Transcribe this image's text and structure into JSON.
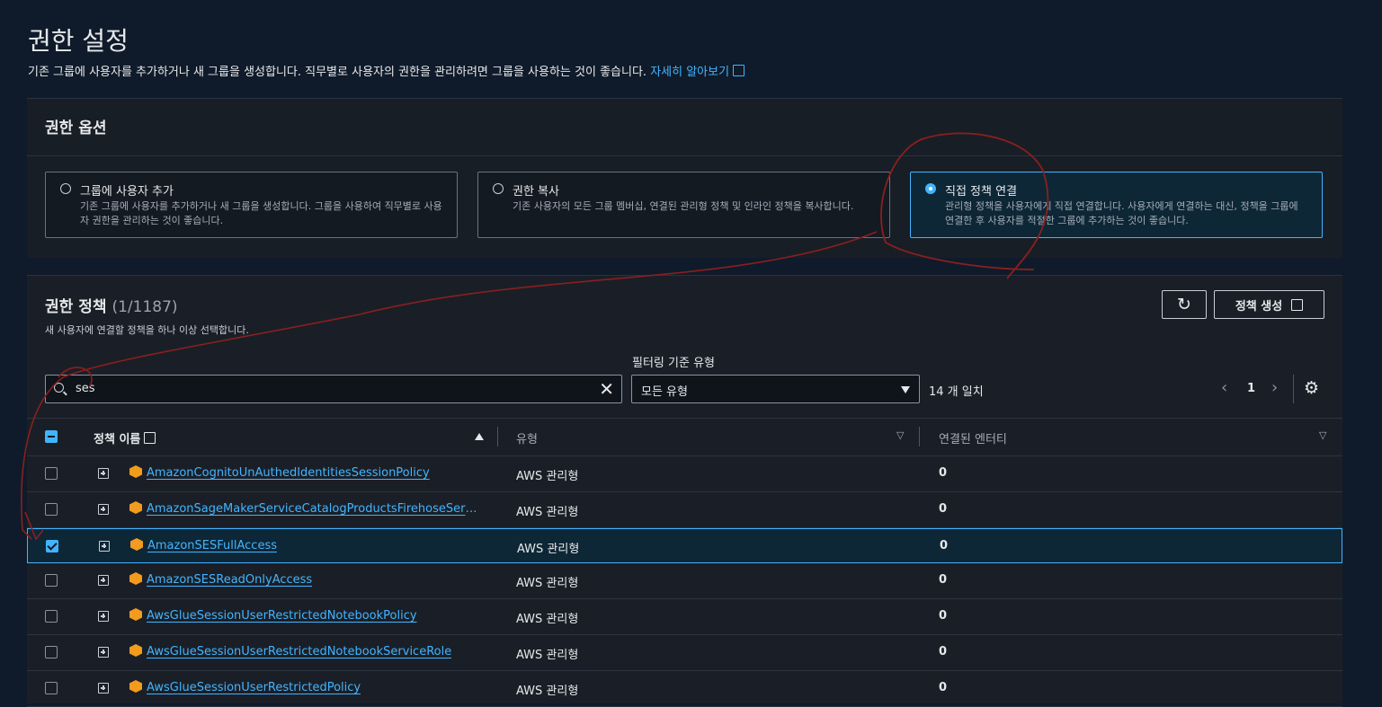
{
  "header": {
    "title": "권한 설정",
    "description": "기존 그룹에 사용자를 추가하거나 새 그룹을 생성합니다. 직무별로 사용자의 권한을 관리하려면 그룹을 사용하는 것이 좋습니다.",
    "learn_more": "자세히 알아보기"
  },
  "options_panel": {
    "title": "권한 옵션",
    "options": [
      {
        "title": "그룹에 사용자 추가",
        "desc": "기존 그룹에 사용자를 추가하거나 새 그룹을 생성합니다. 그룹을 사용하여 직무별로 사용자 권한을 관리하는 것이 좋습니다.",
        "selected": false
      },
      {
        "title": "권한 복사",
        "desc": "기존 사용자의 모든 그룹 멤버십, 연결된 관리형 정책 및 인라인 정책을 복사합니다.",
        "selected": false
      },
      {
        "title": "직접 정책 연결",
        "desc": "관리형 정책을 사용자에게 직접 연결합니다. 사용자에게 연결하는 대신, 정책을 그룹에 연결한 후 사용자를 적절한 그룹에 추가하는 것이 좋습니다.",
        "selected": true
      }
    ]
  },
  "policies_panel": {
    "title": "권한 정책",
    "count": "(1/1187)",
    "description": "새 사용자에 연결할 정책을 하나 이상 선택합니다.",
    "create_button": "정책 생성",
    "filter_label": "필터링 기준 유형",
    "search_value": "ses",
    "filter_value": "모든 유형",
    "match_count": "14 개 일치",
    "page": "1"
  },
  "table": {
    "columns": {
      "name": "정책 이름",
      "type": "유형",
      "entities": "연결된 엔터티"
    },
    "rows": [
      {
        "name": "AmazonCognitoUnAuthedIdentitiesSessionPolicy",
        "type": "AWS 관리형",
        "entities": "0",
        "checked": false
      },
      {
        "name": "AmazonSageMakerServiceCatalogProductsFirehoseServiceRolePolicy",
        "type": "AWS 관리형",
        "entities": "0",
        "checked": false
      },
      {
        "name": "AmazonSESFullAccess",
        "type": "AWS 관리형",
        "entities": "0",
        "checked": true
      },
      {
        "name": "AmazonSESReadOnlyAccess",
        "type": "AWS 관리형",
        "entities": "0",
        "checked": false
      },
      {
        "name": "AwsGlueSessionUserRestrictedNotebookPolicy",
        "type": "AWS 관리형",
        "entities": "0",
        "checked": false
      },
      {
        "name": "AwsGlueSessionUserRestrictedNotebookServiceRole",
        "type": "AWS 관리형",
        "entities": "0",
        "checked": false
      },
      {
        "name": "AwsGlueSessionUserRestrictedPolicy",
        "type": "AWS 관리형",
        "entities": "0",
        "checked": false
      }
    ]
  },
  "colors": {
    "accent": "#42b4ff",
    "background": "#0f1b2a",
    "annotation": "#8b1f1f"
  }
}
